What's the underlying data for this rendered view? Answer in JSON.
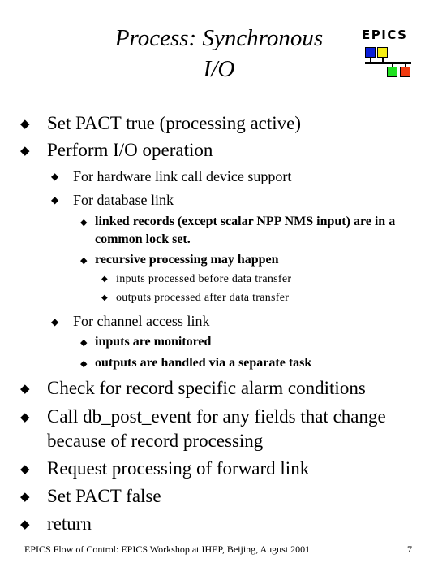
{
  "slide": {
    "title_line1": "Process: Synchronous",
    "title_line2": "I/O",
    "logo": {
      "text": "EPICS",
      "squares": [
        {
          "name": "blue-square",
          "color": "#0a1ed8"
        },
        {
          "name": "yellow-square",
          "color": "#f6ee12"
        },
        {
          "name": "green-square",
          "color": "#20e020"
        },
        {
          "name": "red-square",
          "color": "#f03a10"
        }
      ]
    },
    "bullet_icon": "diamond-bullet-icon",
    "bullet_glyph": "◆",
    "items": [
      {
        "text": "Set PACT true (processing active)"
      },
      {
        "text": "Perform I/O operation",
        "children": [
          {
            "text": "For hardware link call device support"
          },
          {
            "text": "For database link",
            "children": [
              {
                "text_line1": "linked records (except scalar NPP NMS input) are in a",
                "text_line2": "common lock set."
              },
              {
                "text": "recursive processing may happen",
                "children": [
                  {
                    "text": "inputs processed before data transfer"
                  },
                  {
                    "text": "outputs processed after data transfer"
                  }
                ]
              }
            ]
          },
          {
            "text": "For channel access link",
            "children": [
              {
                "text": "inputs are monitored"
              },
              {
                "text": "outputs are handled via a separate task"
              }
            ]
          }
        ]
      },
      {
        "text": "Check for record specific alarm conditions"
      },
      {
        "text_line1": "Call db_post_event for any fields that change",
        "text_line2": "because of record processing"
      },
      {
        "text": "Request processing of forward link"
      },
      {
        "text": "Set PACT false"
      },
      {
        "text": "return"
      }
    ],
    "footer": {
      "text": "EPICS Flow of Control: EPICS Workshop at IHEP, Beijing, August 2001",
      "page_number": "7"
    }
  }
}
